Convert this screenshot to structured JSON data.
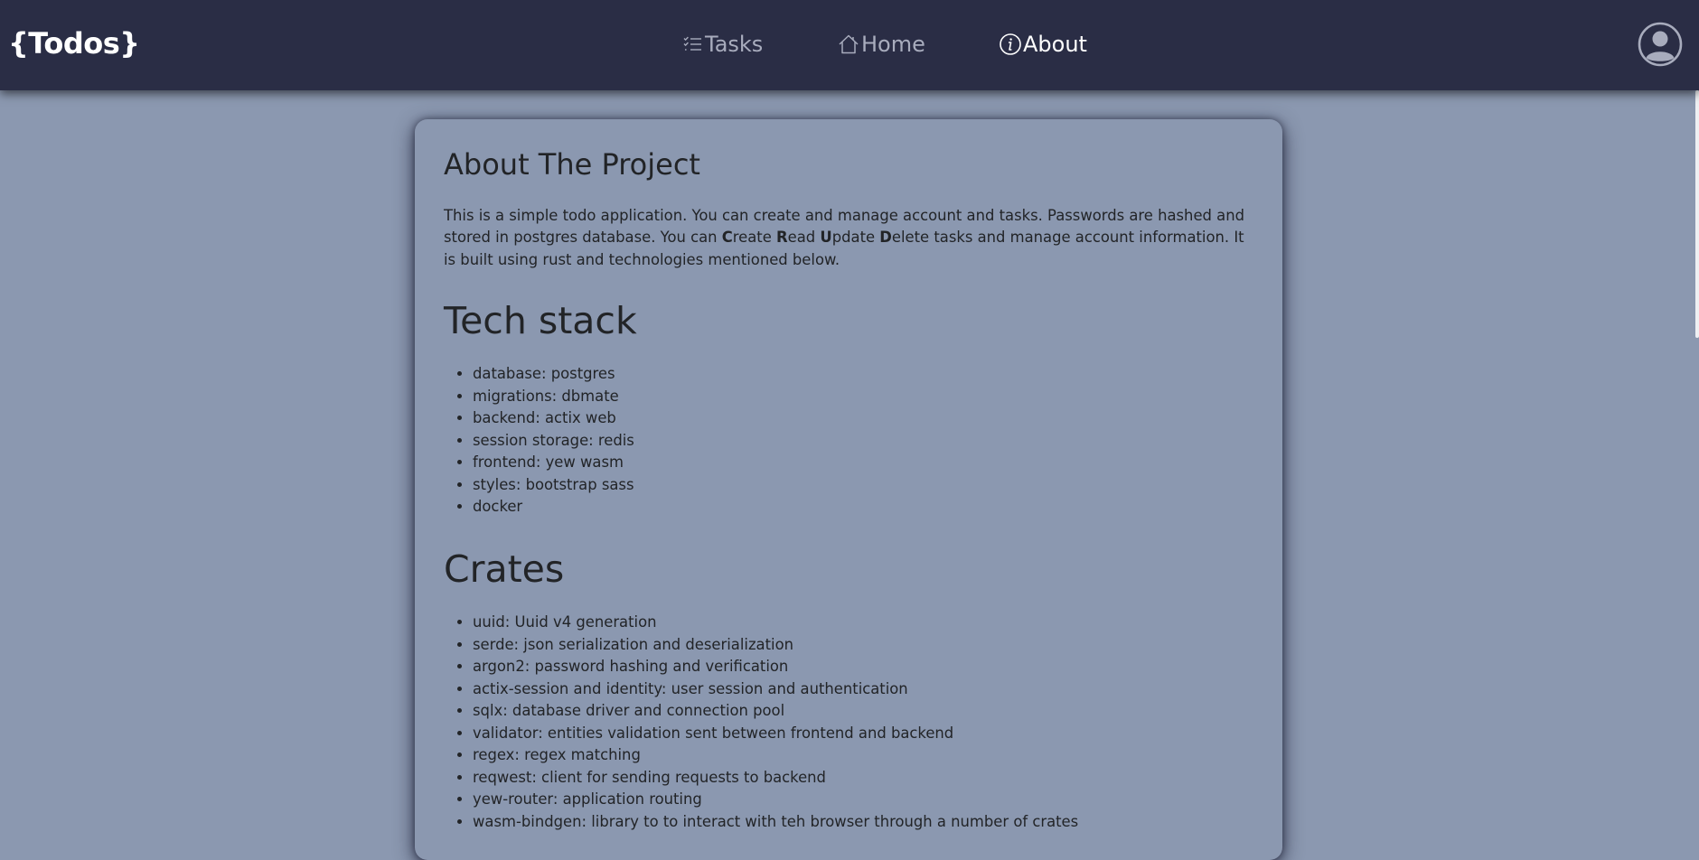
{
  "navbar": {
    "brand": "{Todos}",
    "items": [
      {
        "label": "Tasks",
        "icon": "list-check-icon",
        "active": false
      },
      {
        "label": "Home",
        "icon": "house-icon",
        "active": false
      },
      {
        "label": "About",
        "icon": "info-circle-icon",
        "active": true
      }
    ],
    "avatar_icon": "user-circle-icon"
  },
  "about": {
    "title": "About The Project",
    "text_part1": "This is a simple todo application. You can create and manage account and tasks. Passwords are hashed and stored in postgres database. You can ",
    "c_bold": "C",
    "c_rest": "reate ",
    "r_bold": "R",
    "r_rest": "ead ",
    "u_bold": "U",
    "u_rest": "pdate ",
    "d_bold": "D",
    "d_rest": "elete tasks and manage account information. It is built using rust and technologies mentioned below."
  },
  "tech_stack": {
    "title": "Tech stack",
    "items": [
      "database: postgres",
      "migrations: dbmate",
      "backend: actix web",
      "session storage: redis",
      "frontend: yew wasm",
      "styles: bootstrap sass",
      "docker"
    ]
  },
  "crates": {
    "title": "Crates",
    "items": [
      "uuid: Uuid v4 generation",
      "serde: json serialization and deserialization",
      "argon2: password hashing and verification",
      "actix-session and identity: user session and authentication",
      "sqlx: database driver and connection pool",
      "validator: entities validation sent between frontend and backend",
      "regex: regex matching",
      "reqwest: client for sending requests to backend",
      "yew-router: application routing",
      "wasm-bindgen: library to to interact with teh browser through a number of crates"
    ]
  },
  "colors": {
    "navbar_bg": "#2a2d45",
    "page_bg": "#8b98b0",
    "text_dark": "#222427",
    "nav_inactive": "#a8acbd",
    "nav_active": "#ffffff"
  }
}
